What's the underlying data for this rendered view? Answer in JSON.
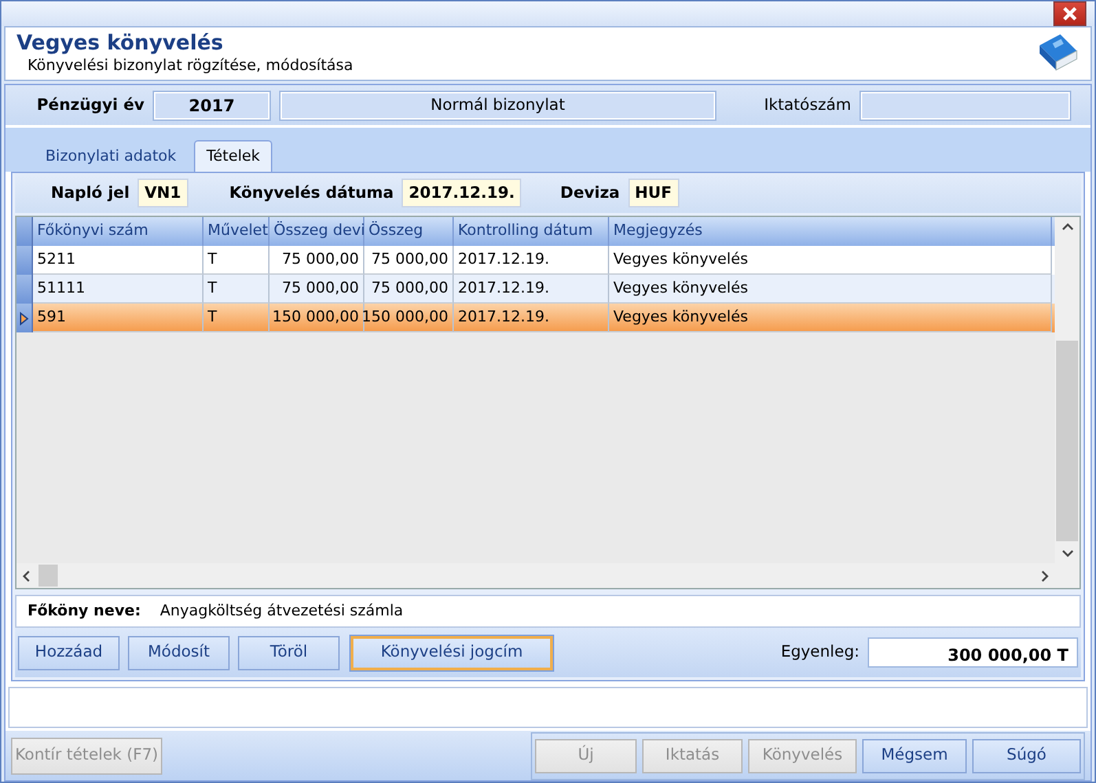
{
  "header": {
    "title": "Vegyes könyvelés",
    "subtitle": "Könyvelési bizonylat rögzítése, módosítása"
  },
  "info": {
    "fiscal_year_label": "Pénzügyi év",
    "fiscal_year": "2017",
    "voucher_type": "Normál bizonylat",
    "filing_number_label": "Iktatószám"
  },
  "tabs": [
    {
      "label": "Bizonylati adatok",
      "selected": false
    },
    {
      "label": "Tételek",
      "selected": true
    }
  ],
  "entry_fields": [
    {
      "label": "Napló jel",
      "value": "VN1"
    },
    {
      "label": "Könyvelés dátuma",
      "value": "2017.12.19."
    },
    {
      "label": "Deviza",
      "value": "HUF"
    }
  ],
  "table": {
    "columns": [
      "Főkönyvi szám",
      "Művelet",
      "Összeg devi",
      "Összeg",
      "Kontrolling dátum",
      "Megjegyzés"
    ],
    "rows": [
      {
        "cells": [
          "5211",
          "T",
          "75 000,00",
          "75 000,00",
          "2017.12.19.",
          "Vegyes könyvelés"
        ],
        "selected": false
      },
      {
        "cells": [
          "51111",
          "T",
          "75 000,00",
          "75 000,00",
          "2017.12.19.",
          "Vegyes könyvelés"
        ],
        "selected": false
      },
      {
        "cells": [
          "591",
          "T",
          "150 000,00",
          "150 000,00",
          "2017.12.19.",
          "Vegyes könyvelés"
        ],
        "selected": true
      }
    ]
  },
  "account_name": {
    "label": "Főköny neve:",
    "value": "Anyagköltség átvezetési számla"
  },
  "actions": [
    {
      "label": "Hozzáad",
      "focused": false
    },
    {
      "label": "Módosít",
      "focused": false
    },
    {
      "label": "Töröl",
      "focused": false
    },
    {
      "label": "Könyvelési jogcím",
      "focused": true
    }
  ],
  "balance": {
    "label": "Egyenleg:",
    "value": "300 000,00 T"
  },
  "footer": {
    "left_button": {
      "label": "Kontír tételek (F7)",
      "disabled": true
    },
    "buttons": [
      {
        "label": "Új",
        "disabled": true
      },
      {
        "label": "Iktatás",
        "disabled": true
      },
      {
        "label": "Könyvelés",
        "disabled": true
      },
      {
        "label": "Mégsem",
        "disabled": false
      },
      {
        "label": "Súgó",
        "disabled": false
      }
    ]
  }
}
